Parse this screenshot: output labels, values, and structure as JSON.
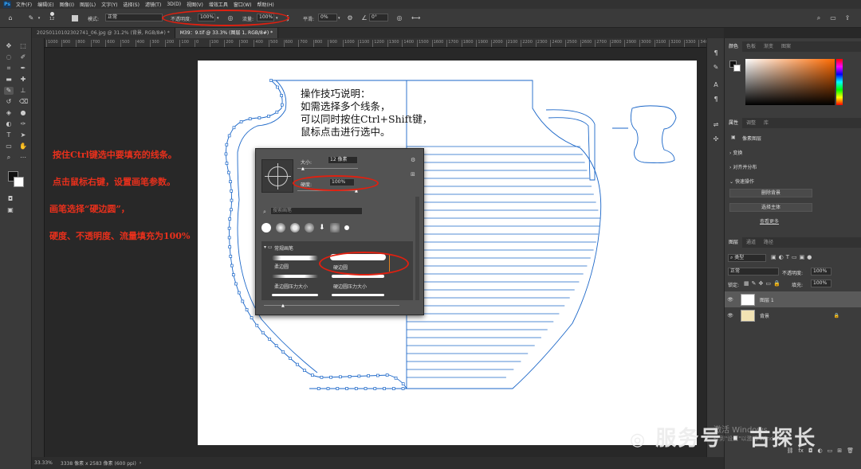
{
  "menu": {
    "logo": "Ps",
    "items": [
      "文件(F)",
      "编辑(E)",
      "图像(I)",
      "图层(L)",
      "文字(Y)",
      "选择(S)",
      "滤镜(T)",
      "3D(D)",
      "视图(V)",
      "增效工具",
      "窗口(W)",
      "帮助(H)"
    ]
  },
  "options": {
    "brush_size": "12",
    "mode_label": "模式:",
    "mode_value": "正常",
    "opacity_label": "不透明度:",
    "opacity_value": "100%",
    "flow_label": "流量:",
    "flow_value": "100%",
    "smooth_label": "平滑:",
    "smooth_value": "0%",
    "angle_value": "0°"
  },
  "tabs": [
    {
      "label": "20250110102302741_06.jpg @ 31.2% (背景, RGB/8#) *",
      "active": false
    },
    {
      "label": "M39：9.tif @ 33.3% (图层 1, RGB/8#) *",
      "active": true
    }
  ],
  "ruler_ticks": [
    "1000",
    "900",
    "800",
    "700",
    "600",
    "500",
    "400",
    "300",
    "200",
    "100",
    "0",
    "100",
    "200",
    "300",
    "400",
    "500",
    "600",
    "700",
    "800",
    "900",
    "1000",
    "1100",
    "1200",
    "1300",
    "1400",
    "1500",
    "1600",
    "1700",
    "1800",
    "1900",
    "2000",
    "2100",
    "2200",
    "2300",
    "2400",
    "2500",
    "2600",
    "2700",
    "2800",
    "2900",
    "3000",
    "3100",
    "3200",
    "3300",
    "3400",
    "3500"
  ],
  "status": {
    "zoom": "33.33%",
    "doc": "3338 像素 x 2583 像素 (600 ppi)"
  },
  "annotations": {
    "left": [
      "按住Ctrl键选中要填充的线条。",
      "点击鼠标右键，设置画笔参数。",
      "画笔选择“硬边圆”，",
      "硬度、不透明度、流量填充为100%"
    ],
    "note": [
      "操作技巧说明：",
      "如需选择多个线条，",
      "可以同时按住Ctrl+Shift键，",
      "鼠标点击进行选中。"
    ]
  },
  "brush_popup": {
    "size_label": "大小:",
    "size_value": "12 像素",
    "hardness_label": "硬度:",
    "hardness_value": "100%",
    "search_placeholder": "搜索画笔",
    "group_label": "常规画笔",
    "brushes": [
      "柔边圆",
      "硬边圆",
      "柔边圆压力大小",
      "硬边圆压力大小"
    ]
  },
  "color_panel": {
    "tabs": [
      "颜色",
      "色板",
      "渐变",
      "图案"
    ]
  },
  "properties": {
    "tabs": [
      "属性",
      "调整",
      "库"
    ],
    "header": "像素图层",
    "sections": [
      "变换",
      "对齐并分布",
      "快速操作"
    ],
    "buttons": [
      "删除背景",
      "选择主体"
    ],
    "more": "查看更多"
  },
  "layers": {
    "tabs": [
      "图层",
      "通道",
      "路径"
    ],
    "kind": "类型",
    "blend": "正常",
    "opacity_label": "不透明度:",
    "opacity_value": "100%",
    "lock_label": "锁定:",
    "fill_label": "填充:",
    "fill_value": "100%",
    "items": [
      {
        "name": "图层 1",
        "selected": true
      },
      {
        "name": "背景",
        "selected": false
      }
    ]
  },
  "watermark": {
    "activate": "激活 Windows",
    "activate_sub": "转到\"设置\"以激活 Windows。",
    "brand": "服务号 · 古探长"
  }
}
